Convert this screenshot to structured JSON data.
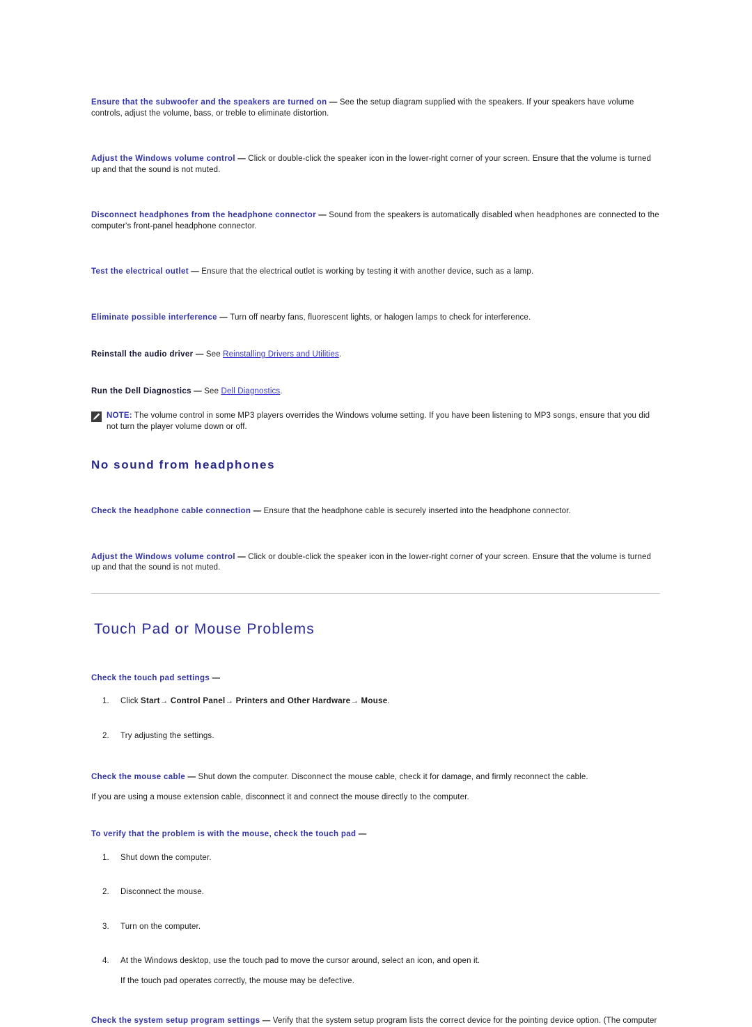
{
  "document": {
    "title": "Dell Support - Troubleshooting: Sound and Touch Pad or Mouse Problems"
  },
  "colors": {
    "lead_blue": "#3333aa",
    "link_blue": "#3333cc",
    "heading_navy": "#282888",
    "section_heading_blue": "#2a2a99",
    "body_text": "#1a1a1a",
    "rule_gray": "#c8c8c8",
    "note_icon_bg": "#3b3b3b"
  },
  "sound_tips": [
    {
      "lead": "Ensure that the subwoofer and the speakers are turned on",
      "dash": " — ",
      "body": "See the setup diagram supplied with the speakers. If your speakers have volume controls, adjust the volume, bass, or treble to eliminate distortion."
    },
    {
      "lead": "Adjust the Windows volume control",
      "dash": " — ",
      "body": "Click or double-click the speaker icon in the lower-right corner of your screen. Ensure that the volume is turned up and that the sound is not muted."
    },
    {
      "lead": "Disconnect headphones from the headphone connector",
      "dash": " — ",
      "body": "Sound from the speakers is automatically disabled when headphones are connected to the computer's front-panel headphone connector."
    },
    {
      "lead": "Test the electrical outlet",
      "dash": " — ",
      "body": "Ensure that the electrical outlet is working by testing it with another device, such as a lamp."
    },
    {
      "lead": "Eliminate possible interference",
      "dash": " — ",
      "body": "Turn off nearby fans, fluorescent lights, or halogen lamps to check for interference."
    }
  ],
  "driver_tip": {
    "lead": "Reinstall the audio driver",
    "dash": " — ",
    "see": "See ",
    "link": "Reinstalling Drivers and Utilities",
    "period": "."
  },
  "diagnostics_tip": {
    "lead": "Run the Dell Diagnostics",
    "dash": " — ",
    "see": "See ",
    "link": "Dell Diagnostics",
    "period": "."
  },
  "note": {
    "icon": "pencil-note-icon",
    "label": "NOTE:",
    "body": " The volume control in some MP3 players overrides the Windows volume setting. If you have been listening to MP3 songs, ensure that you did not turn the player volume down or off."
  },
  "headphones_section": {
    "heading": "No sound from headphones",
    "tips": [
      {
        "lead": "Check the headphone cable connection",
        "dash": " — ",
        "body": "Ensure that the headphone cable is securely inserted into the headphone connector."
      },
      {
        "lead": "Adjust the Windows volume control",
        "dash": " — ",
        "body": "Click or double-click the speaker icon in the lower-right corner of your screen. Ensure that the volume is turned up and that the sound is not muted."
      }
    ]
  },
  "touchpad_section": {
    "heading": "Touch Pad or Mouse Problems",
    "touchpad_settings": {
      "lead": "Check the touch pad settings",
      "dash": " —",
      "steps": [
        {
          "prefix": "Click ",
          "ui_path": [
            {
              "label": "Start",
              "arrow": "→"
            },
            {
              "label": " Control Panel",
              "arrow": "→"
            },
            {
              "label": " Printers and Other Hardware",
              "arrow": "→"
            },
            {
              "label": " Mouse",
              "arrow": ""
            }
          ],
          "suffix": "."
        },
        {
          "plain": "Try adjusting the settings."
        }
      ]
    },
    "mouse_cable": {
      "lead": "Check the mouse cable",
      "dash": " — ",
      "body": "Shut down the computer. Disconnect the mouse cable, check it for damage, and firmly reconnect the cable.",
      "follow_up": "If you are using a mouse extension cable, disconnect it and connect the mouse directly to the computer."
    },
    "verify_mouse": {
      "lead": "To verify that the problem is with the mouse, check the touch pad",
      "dash": " —",
      "steps": [
        {
          "plain": "Shut down the computer."
        },
        {
          "plain": "Disconnect the mouse."
        },
        {
          "plain": "Turn on the computer."
        },
        {
          "plain": "At the Windows desktop, use the touch pad to move the cursor around, select an icon, and open it.",
          "sub_line": "If the touch pad operates correctly, the mouse may be defective."
        }
      ]
    },
    "system_setup": {
      "lead": "Check the system setup program settings",
      "dash": " — ",
      "body": "Verify that the system setup program lists the correct device for the pointing device option. (The computer"
    }
  }
}
